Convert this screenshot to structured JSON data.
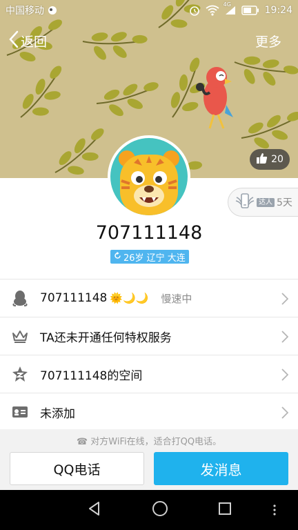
{
  "status_bar": {
    "carrier": "中国移动",
    "network": "4G",
    "time": "19:24"
  },
  "nav": {
    "back_label": "返回",
    "more_label": "更多"
  },
  "profile": {
    "likes": "20",
    "expert_tag": "达人",
    "expert_days": "5天",
    "uid": "707111148",
    "info_tag": "26岁 辽宁 大连"
  },
  "list": {
    "qq": {
      "label": "707111148",
      "emoji": "🌞🌙🌙",
      "status": "慢速中"
    },
    "privilege": {
      "label": "TA还未开通任何特权服务"
    },
    "space": {
      "label": "707111148的空间"
    },
    "card": {
      "label": "未添加"
    }
  },
  "bottom": {
    "hint": "对方WiFi在线，适合打QQ电话。",
    "call_button": "QQ电话",
    "message_button": "发消息"
  },
  "colors": {
    "accent": "#1fb2ed",
    "cover": "#cfc08e",
    "leaf": "#a9a632",
    "avatar_bg": "#45c3c0"
  }
}
